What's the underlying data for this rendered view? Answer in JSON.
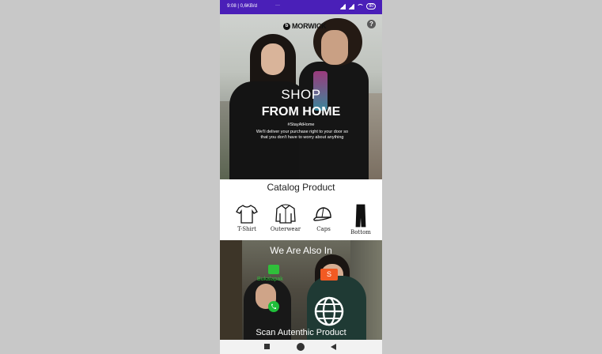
{
  "status_bar": {
    "time_info": "9:08 | 0,6KB/d",
    "more": "···",
    "battery": "80"
  },
  "hero": {
    "brand": "MORWICK",
    "title_line1": "SHOP",
    "title_line2": "FROM HOME",
    "hashtag": "#StayAtHome",
    "description": "We'll deliver your purchase right to your door so that you don't have to worry about anything"
  },
  "catalog": {
    "title": "Catalog Product",
    "items": [
      {
        "label": "T-Shirt",
        "icon": "tshirt-icon"
      },
      {
        "label": "Outerwear",
        "icon": "jacket-icon"
      },
      {
        "label": "Caps",
        "icon": "cap-icon"
      },
      {
        "label": "Bottom",
        "icon": "pants-icon"
      }
    ]
  },
  "promo": {
    "title": "We Are Also In",
    "marketplaces": [
      {
        "label": "Bukalapak",
        "color": "#2fbf3a",
        "icon": "bukalapak-icon"
      },
      {
        "label": "S",
        "color": "#f25a23",
        "icon": "shopee-icon"
      }
    ],
    "whatsapp_color": "#1fbf3a",
    "scan_label": "Scan Autenthic Product"
  },
  "colors": {
    "status_bar": "#4a1fb8",
    "background": "#c8c8c8"
  }
}
